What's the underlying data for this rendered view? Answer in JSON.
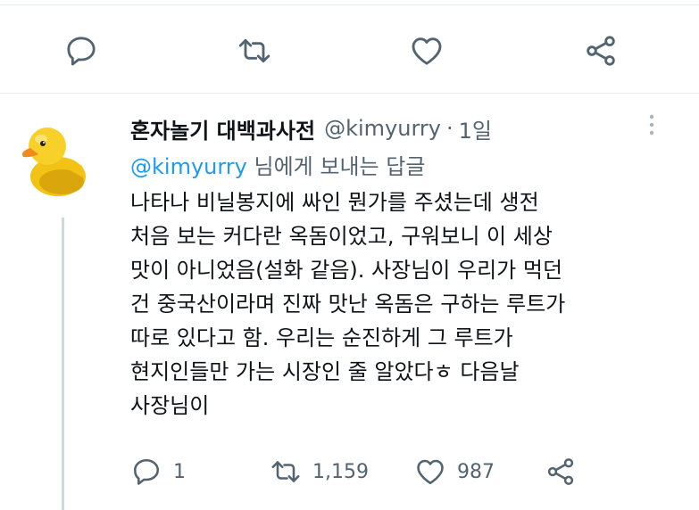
{
  "top_actions": [
    {
      "name": "reply",
      "icon": "speech-bubble-icon"
    },
    {
      "name": "retweet",
      "icon": "retweet-icon"
    },
    {
      "name": "like",
      "icon": "heart-icon"
    },
    {
      "name": "share",
      "icon": "share-icon"
    }
  ],
  "tweet": {
    "avatar": "rubber-duck",
    "display_name": "혼자놀기 대백과사전",
    "handle": "@kimyurry",
    "separator": "·",
    "time": "1일",
    "reply_to_handle": "@kimyurry",
    "reply_to_suffix": " 님에게 보내는 답글",
    "body_lines": [
      "나타나 비닐봉지에 싸인 뭔가를 주셨는데 생전",
      "처음 보는 커다란 옥돔이었고, 구워보니 이 세상",
      "맛이 아니었음(설화 같음). 사장님이 우리가 먹던",
      "건 중국산이라며 진짜 맛난 옥돔은 구하는 루트가",
      "따로 있다고 함. 우리는 순진하게 그 루트가",
      "현지인들만 가는 시장인 줄 알았다ㅎ 다음날",
      "사장님이"
    ],
    "metrics": {
      "replies": "1",
      "retweets": "1,159",
      "likes": "987"
    }
  },
  "colors": {
    "icon_gray": "#536471",
    "link_blue": "#1d9bf0",
    "divider": "#e6ecf0",
    "thread_line": "#cfd9de"
  }
}
